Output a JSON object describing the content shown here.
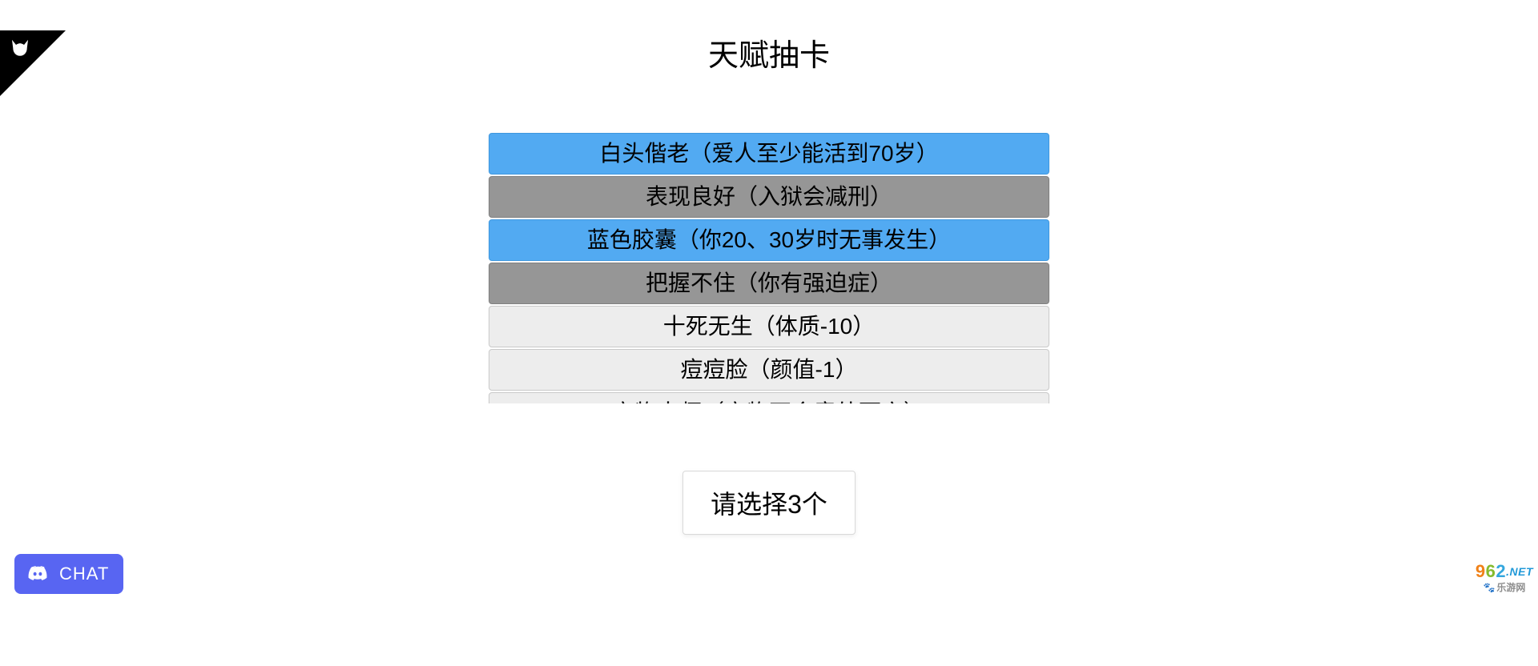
{
  "title": "天赋抽卡",
  "talents": [
    {
      "label": "白头偕老（爱人至少能活到70岁）",
      "grade": "blue"
    },
    {
      "label": "表现良好（入狱会减刑）",
      "grade": "gray"
    },
    {
      "label": "蓝色胶囊（你20、30岁时无事发生）",
      "grade": "blue"
    },
    {
      "label": "把握不住（你有强迫症）",
      "grade": "gray"
    },
    {
      "label": "十死无生（体质-10）",
      "grade": "common"
    },
    {
      "label": "痘痘脸（颜值-1）",
      "grade": "common"
    },
    {
      "label": "宠物大师（宠物不会意外死亡）",
      "grade": "common"
    }
  ],
  "select_button_label": "请选择3个",
  "chat": {
    "label": "CHAT"
  },
  "watermark": {
    "main_digits": [
      "9",
      "6",
      "2"
    ],
    "net": ".NET",
    "sub": "乐游网"
  },
  "corner_icon_name": "cat-icon",
  "colors": {
    "blue_tile": "#52aaf2",
    "gray_tile": "#969696",
    "common_tile": "#ededed",
    "discord": "#5865f2"
  }
}
